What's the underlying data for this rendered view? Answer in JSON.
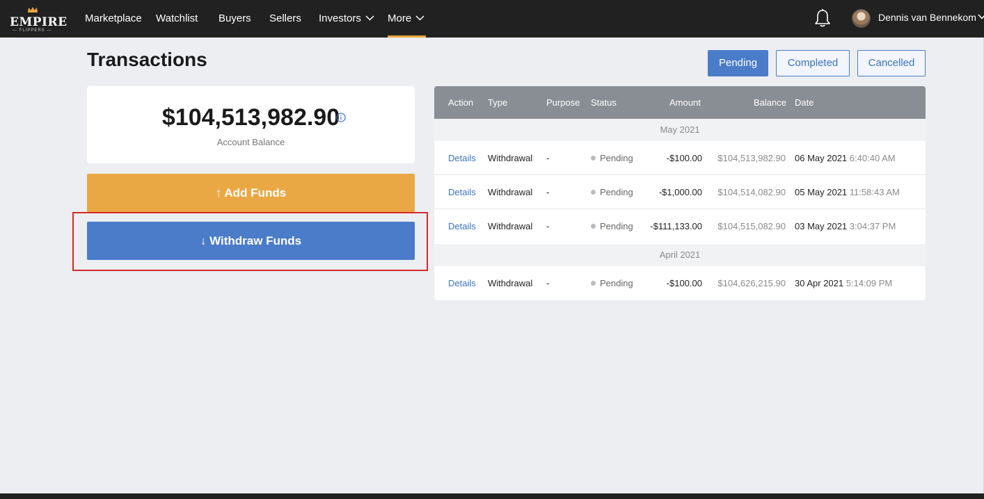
{
  "nav": {
    "logo_word": "EMPIRE",
    "logo_sub": "— FLIPPERS —",
    "items": [
      {
        "label": "Marketplace"
      },
      {
        "label": "Watchlist"
      },
      {
        "label": "Buyers"
      },
      {
        "label": "Sellers"
      },
      {
        "label": "Investors",
        "dropdown": true
      },
      {
        "label": "More",
        "dropdown": true,
        "active": true
      }
    ],
    "user_name": "Dennis van Bennekom",
    "icons": {
      "notifications": "bell-icon",
      "user_menu": "chevron-down-icon"
    }
  },
  "page": {
    "title": "Transactions",
    "filters": [
      {
        "label": "Pending",
        "active": true
      },
      {
        "label": "Completed",
        "active": false
      },
      {
        "label": "Cancelled",
        "active": false
      }
    ]
  },
  "balance": {
    "amount": "$104,513,982.90",
    "label": "Account Balance",
    "info_icon": "info-icon"
  },
  "actions": {
    "add_funds": "Add Funds",
    "add_icon": "↑",
    "withdraw_funds": "Withdraw Funds",
    "withdraw_icon": "↓"
  },
  "table": {
    "headers": {
      "action": "Action",
      "type": "Type",
      "purpose": "Purpose",
      "status": "Status",
      "amount": "Amount",
      "balance": "Balance",
      "date": "Date"
    },
    "groups": [
      {
        "label": "May 2021",
        "rows": [
          {
            "action": "Details",
            "type": "Withdrawal",
            "purpose": "-",
            "status": "Pending",
            "amount": "-$100.00",
            "balance": "$104,513,982.90",
            "date": "06 May 2021",
            "time": "6:40:40 AM"
          },
          {
            "action": "Details",
            "type": "Withdrawal",
            "purpose": "-",
            "status": "Pending",
            "amount": "-$1,000.00",
            "balance": "$104,514,082.90",
            "date": "05 May 2021",
            "time": "11:58:43 AM"
          },
          {
            "action": "Details",
            "type": "Withdrawal",
            "purpose": "-",
            "status": "Pending",
            "amount": "-$111,133.00",
            "balance": "$104,515,082.90",
            "date": "03 May 2021",
            "time": "3:04:37 PM"
          }
        ]
      },
      {
        "label": "April 2021",
        "rows": [
          {
            "action": "Details",
            "type": "Withdrawal",
            "purpose": "-",
            "status": "Pending",
            "amount": "-$100.00",
            "balance": "$104,626,215.90",
            "date": "30 Apr 2021",
            "time": "5:14:09 PM"
          }
        ]
      }
    ]
  },
  "colors": {
    "nav_bg": "#212121",
    "accent_blue": "#4a7cc9",
    "add_funds_orange": "#eaa845",
    "highlight_red": "#d42b2b"
  }
}
